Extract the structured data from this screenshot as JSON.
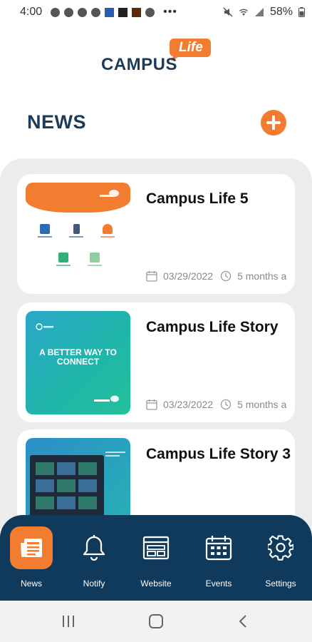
{
  "status_bar": {
    "time": "4:00",
    "more": "•••",
    "battery": "58%"
  },
  "logo": {
    "word": "CAMPUS",
    "accent": "Life"
  },
  "header": {
    "title": "NEWS"
  },
  "news": [
    {
      "title": "Campus Life 5",
      "date": "03/29/2022",
      "ago": "5 months a"
    },
    {
      "title": "Campus Life Story",
      "date": "03/23/2022",
      "ago": "5 months a",
      "thumb_text": "A BETTER WAY TO CONNECT"
    },
    {
      "title": "Campus Life Story 3"
    }
  ],
  "nav": {
    "items": [
      {
        "label": "News",
        "icon": "newspaper-icon",
        "active": true
      },
      {
        "label": "Notify",
        "icon": "bell-icon"
      },
      {
        "label": "Website",
        "icon": "browser-icon"
      },
      {
        "label": "Events",
        "icon": "calendar-icon"
      },
      {
        "label": "Settings",
        "icon": "gear-icon"
      }
    ]
  },
  "colors": {
    "accent": "#f27d31",
    "navy": "#103a5b",
    "title": "#1c3b57",
    "panel": "#ececec"
  }
}
